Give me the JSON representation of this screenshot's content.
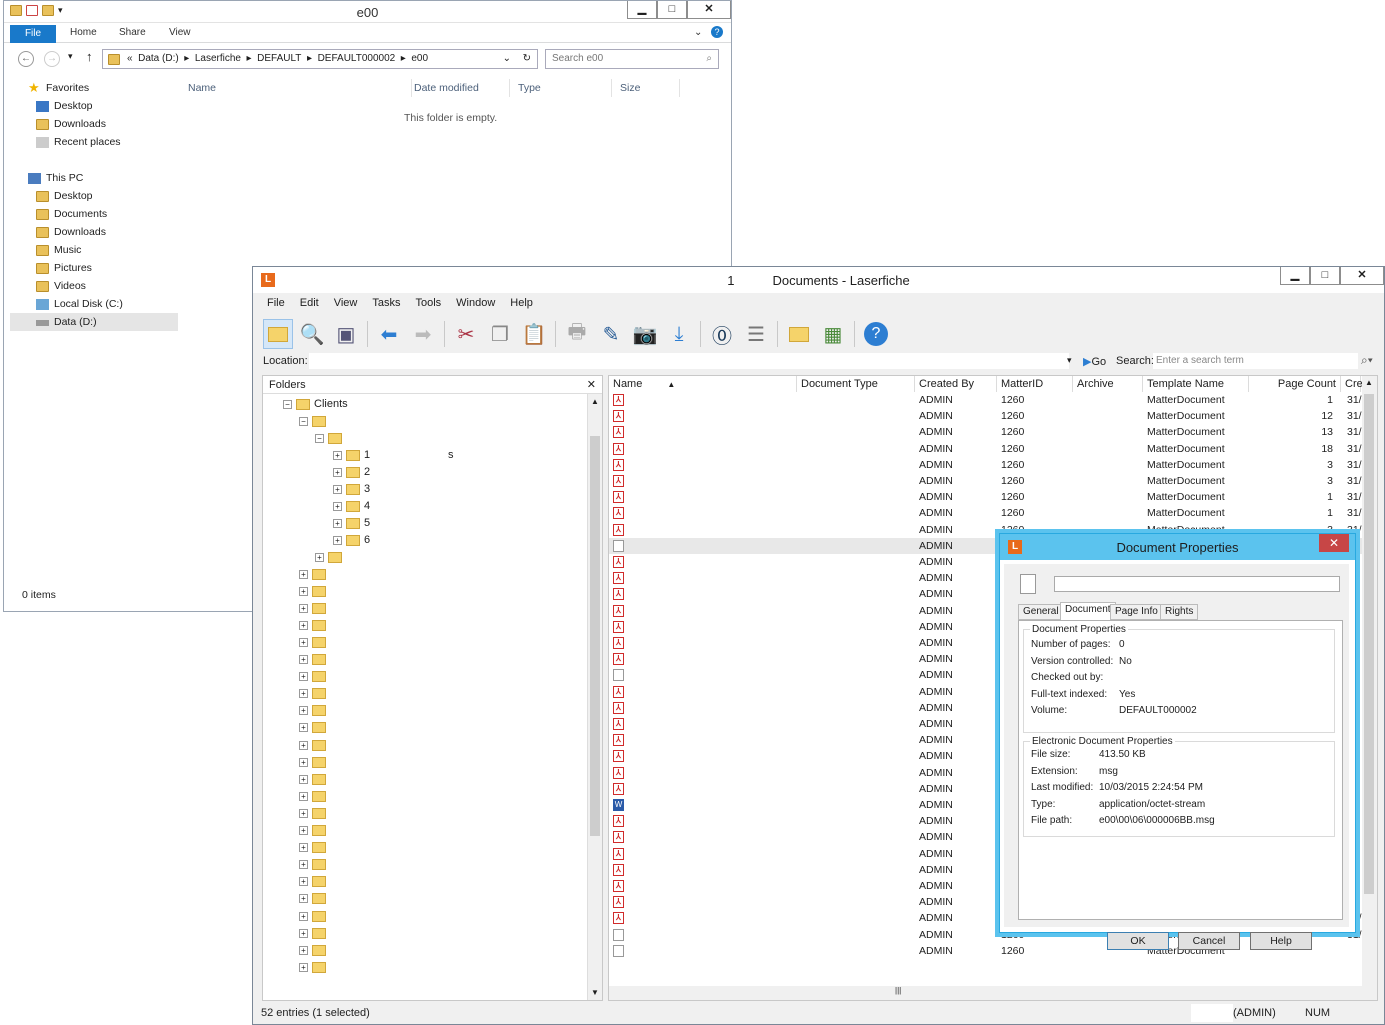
{
  "explorer": {
    "title": "e00",
    "ribbon": {
      "file": "File",
      "home": "Home",
      "share": "Share",
      "view": "View"
    },
    "address": [
      "«",
      "Data (D:)",
      "▸",
      "Laserfiche",
      "▸",
      "DEFAULT",
      "▸",
      "DEFAULT000002",
      "▸",
      "e00"
    ],
    "search_placeholder": "Search e00",
    "columns": [
      "Name",
      "Date modified",
      "Type",
      "Size"
    ],
    "empty": "This folder is empty.",
    "favorites": {
      "label": "Favorites",
      "items": [
        "Desktop",
        "Downloads",
        "Recent places"
      ]
    },
    "thispc": {
      "label": "This PC",
      "items": [
        "Desktop",
        "Documents",
        "Downloads",
        "Music",
        "Pictures",
        "Videos",
        "Local Disk (C:)",
        "Data (D:)"
      ]
    },
    "status": "0 items"
  },
  "laserfiche": {
    "title": "Documents - Laserfiche",
    "title_prefix": "1",
    "logo": "L",
    "menu": [
      "File",
      "Edit",
      "View",
      "Tasks",
      "Tools",
      "Window",
      "Help"
    ],
    "location_label": "Location:",
    "go": "Go",
    "search_label": "Search:",
    "search_placeholder": "Enter a search term",
    "folders_title": "Folders",
    "tree_root": "Clients",
    "tree_nums": [
      "1",
      "2",
      "3",
      "4",
      "5",
      "6"
    ],
    "tree_s": "s",
    "columns": [
      "Name",
      "Document Type",
      "Created By",
      "MatterID",
      "Archive",
      "Template Name",
      "Page Count",
      "Cre"
    ],
    "rows": [
      {
        "icon": "pdf",
        "by": "ADMIN",
        "matter": "1260",
        "template": "MatterDocument",
        "pages": "1",
        "cre": "31/"
      },
      {
        "icon": "pdf",
        "by": "ADMIN",
        "matter": "1260",
        "template": "MatterDocument",
        "pages": "12",
        "cre": "31/"
      },
      {
        "icon": "pdf",
        "by": "ADMIN",
        "matter": "1260",
        "template": "MatterDocument",
        "pages": "13",
        "cre": "31/"
      },
      {
        "icon": "pdf",
        "by": "ADMIN",
        "matter": "1260",
        "template": "MatterDocument",
        "pages": "18",
        "cre": "31/"
      },
      {
        "icon": "pdf",
        "by": "ADMIN",
        "matter": "1260",
        "template": "MatterDocument",
        "pages": "3",
        "cre": "31/"
      },
      {
        "icon": "pdf",
        "by": "ADMIN",
        "matter": "1260",
        "template": "MatterDocument",
        "pages": "3",
        "cre": "31/"
      },
      {
        "icon": "pdf",
        "by": "ADMIN",
        "matter": "1260",
        "template": "MatterDocument",
        "pages": "1",
        "cre": "31/"
      },
      {
        "icon": "pdf",
        "by": "ADMIN",
        "matter": "1260",
        "template": "MatterDocument",
        "pages": "1",
        "cre": "31/"
      },
      {
        "icon": "pdf",
        "by": "ADMIN",
        "matter": "1260",
        "template": "MatterDocument",
        "pages": "3",
        "cre": "31/"
      },
      {
        "icon": "blank",
        "by": "ADMIN",
        "matter": "",
        "template": "",
        "pages": "",
        "cre": ""
      },
      {
        "icon": "pdf",
        "by": "ADMIN",
        "matter": "",
        "template": "",
        "pages": "",
        "cre": ""
      },
      {
        "icon": "pdf",
        "by": "ADMIN",
        "matter": "",
        "template": "",
        "pages": "",
        "cre": ""
      },
      {
        "icon": "pdf",
        "by": "ADMIN",
        "matter": "",
        "template": "",
        "pages": "",
        "cre": ""
      },
      {
        "icon": "pdf",
        "by": "ADMIN",
        "matter": "",
        "template": "",
        "pages": "",
        "cre": ""
      },
      {
        "icon": "pdf",
        "by": "ADMIN",
        "matter": "",
        "template": "",
        "pages": "",
        "cre": ""
      },
      {
        "icon": "pdf",
        "by": "ADMIN",
        "matter": "",
        "template": "",
        "pages": "",
        "cre": ""
      },
      {
        "icon": "pdf",
        "by": "ADMIN",
        "matter": "",
        "template": "",
        "pages": "",
        "cre": ""
      },
      {
        "icon": "blank",
        "by": "ADMIN",
        "matter": "",
        "template": "",
        "pages": "",
        "cre": ""
      },
      {
        "icon": "pdf",
        "by": "ADMIN",
        "matter": "",
        "template": "",
        "pages": "",
        "cre": ""
      },
      {
        "icon": "pdf",
        "by": "ADMIN",
        "matter": "",
        "template": "",
        "pages": "",
        "cre": ""
      },
      {
        "icon": "pdf",
        "by": "ADMIN",
        "matter": "",
        "template": "",
        "pages": "",
        "cre": ""
      },
      {
        "icon": "pdf",
        "by": "ADMIN",
        "matter": "",
        "template": "",
        "pages": "",
        "cre": ""
      },
      {
        "icon": "pdf",
        "by": "ADMIN",
        "matter": "",
        "template": "",
        "pages": "",
        "cre": ""
      },
      {
        "icon": "pdf",
        "by": "ADMIN",
        "matter": "",
        "template": "",
        "pages": "",
        "cre": ""
      },
      {
        "icon": "pdf",
        "by": "ADMIN",
        "matter": "",
        "template": "",
        "pages": "",
        "cre": ""
      },
      {
        "icon": "word",
        "by": "ADMIN",
        "matter": "",
        "template": "",
        "pages": "",
        "cre": ""
      },
      {
        "icon": "pdf",
        "by": "ADMIN",
        "matter": "",
        "template": "",
        "pages": "",
        "cre": ""
      },
      {
        "icon": "pdf",
        "by": "ADMIN",
        "matter": "",
        "template": "",
        "pages": "",
        "cre": ""
      },
      {
        "icon": "pdf",
        "by": "ADMIN",
        "matter": "",
        "template": "",
        "pages": "",
        "cre": ""
      },
      {
        "icon": "pdf",
        "by": "ADMIN",
        "matter": "",
        "template": "",
        "pages": "",
        "cre": ""
      },
      {
        "icon": "pdf",
        "by": "ADMIN",
        "matter": "",
        "template": "",
        "pages": "",
        "cre": ""
      },
      {
        "icon": "pdf",
        "by": "ADMIN",
        "matter": "",
        "template": "",
        "pages": "",
        "cre": ""
      },
      {
        "icon": "pdf",
        "by": "ADMIN",
        "matter": "1260",
        "template": "MatterDocument",
        "pages": "1",
        "cre": "31/"
      },
      {
        "icon": "blank",
        "by": "ADMIN",
        "matter": "1260",
        "template": "MatterDocument",
        "pages": "",
        "cre": "31/"
      },
      {
        "icon": "blank",
        "by": "ADMIN",
        "matter": "1260",
        "template": "MatterDocument",
        "pages": "",
        "cre": ""
      }
    ],
    "status": "52 entries (1 selected)",
    "status_user": "(ADMIN)",
    "status_num": "NUM"
  },
  "dialog": {
    "title": "Document Properties",
    "logo": "L",
    "close": "✕",
    "tabs": [
      "General",
      "Document",
      "Page Info",
      "Rights"
    ],
    "group1": "Document Properties",
    "props1": [
      [
        "Number of pages:",
        "0"
      ],
      [
        "Version controlled:",
        "No"
      ],
      [
        "Checked out by:",
        ""
      ],
      [
        "Full-text indexed:",
        "Yes"
      ],
      [
        "Volume:",
        "DEFAULT000002"
      ]
    ],
    "group2": "Electronic Document Properties",
    "props2": [
      [
        "File size:",
        "413.50 KB"
      ],
      [
        "Extension:",
        "msg"
      ],
      [
        "Last modified:",
        "10/03/2015 2:24:54 PM"
      ],
      [
        "Type:",
        "application/octet-stream"
      ],
      [
        "File path:",
        "e00\\00\\06\\000006BB.msg"
      ]
    ],
    "ok": "OK",
    "cancel": "Cancel",
    "help": "Help"
  }
}
